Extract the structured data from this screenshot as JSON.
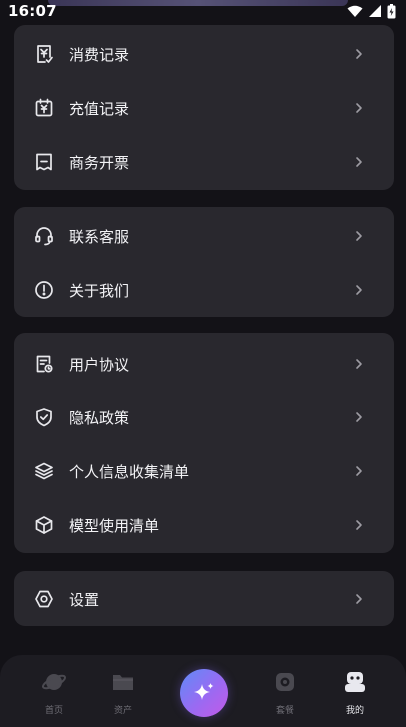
{
  "status_bar": {
    "time": "16:07"
  },
  "groups": [
    {
      "items": [
        {
          "label": "消费记录",
          "icon": "receipt-yen-icon"
        },
        {
          "label": "充值记录",
          "icon": "calendar-yen-icon"
        },
        {
          "label": "商务开票",
          "icon": "invoice-icon"
        }
      ]
    },
    {
      "items": [
        {
          "label": "联系客服",
          "icon": "headset-icon"
        },
        {
          "label": "关于我们",
          "icon": "info-icon"
        }
      ]
    },
    {
      "items": [
        {
          "label": "用户协议",
          "icon": "agreement-doc-icon"
        },
        {
          "label": "隐私政策",
          "icon": "shield-check-icon"
        },
        {
          "label": "个人信息收集清单",
          "icon": "layers-icon"
        },
        {
          "label": "模型使用清单",
          "icon": "cube-icon"
        }
      ]
    },
    {
      "items": [
        {
          "label": "设置",
          "icon": "settings-hexagon-icon"
        }
      ]
    }
  ],
  "tab_bar": {
    "tabs": [
      {
        "label": "首页",
        "icon": "planet-icon"
      },
      {
        "label": "资产",
        "icon": "folder-icon"
      },
      {
        "label": "套餐",
        "icon": "package-icon"
      },
      {
        "label": "我的",
        "icon": "robot-face-icon",
        "active": true
      }
    ],
    "center_button_icon": "sparkle-icon"
  },
  "colors": {
    "background": "#131217",
    "card": "#29282e",
    "tab_bar": "#1d1c22",
    "accent_gradient": [
      "#5e8cf7",
      "#9a6af2",
      "#c35ae8"
    ]
  }
}
